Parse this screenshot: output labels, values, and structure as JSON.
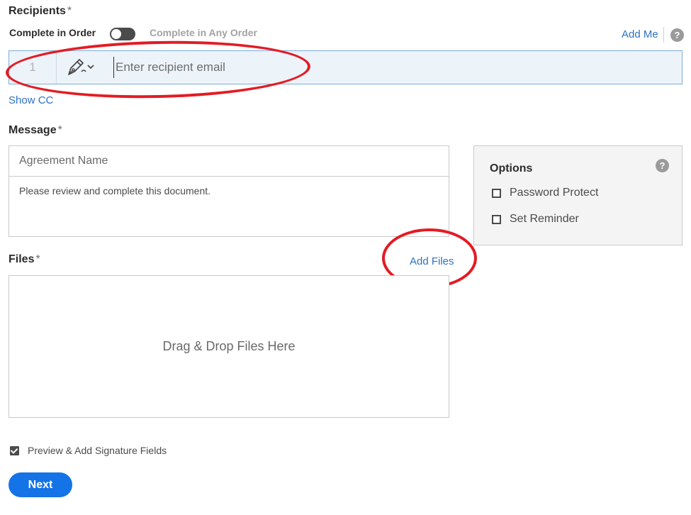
{
  "recipients": {
    "label": "Recipients",
    "required_mark": "*",
    "order_label": "Complete in Order",
    "any_order_label": "Complete in Any Order",
    "add_me": "Add Me",
    "help_glyph": "?",
    "row": {
      "index": "1",
      "role_icon": "pen-signer-icon",
      "email_placeholder": "Enter recipient email",
      "email_value": ""
    },
    "show_cc": "Show CC"
  },
  "message": {
    "label": "Message",
    "required_mark": "*",
    "agreement_name_placeholder": "Agreement Name",
    "body": "Please review and complete this document."
  },
  "options": {
    "title": "Options",
    "help_glyph": "?",
    "items": [
      {
        "label": "Password Protect",
        "checked": false
      },
      {
        "label": "Set Reminder",
        "checked": false
      }
    ]
  },
  "files": {
    "label": "Files",
    "required_mark": "*",
    "add_files": "Add Files",
    "drop_text": "Drag & Drop Files Here"
  },
  "preview": {
    "label": "Preview & Add Signature Fields",
    "checked": true
  },
  "next_button": "Next",
  "annotation_color": "#e31b23",
  "accent_color": "#1473e6"
}
